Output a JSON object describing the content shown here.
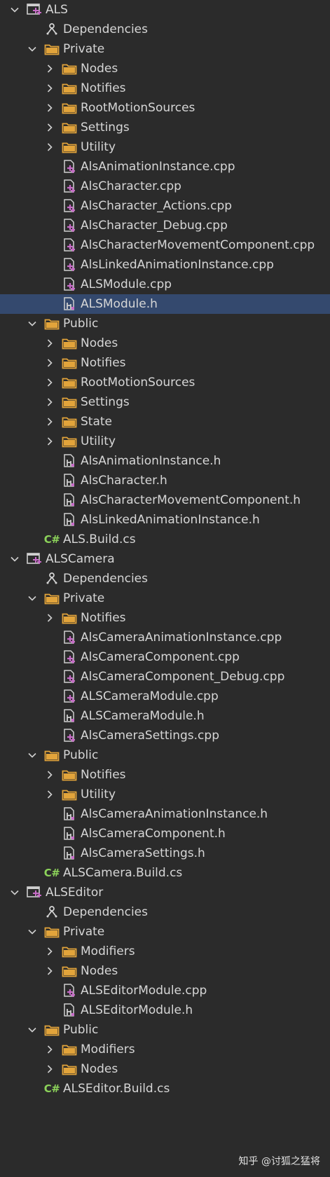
{
  "tree": [
    {
      "depth": 0,
      "type": "project",
      "chevron": "down",
      "label": "ALS"
    },
    {
      "depth": 1,
      "type": "deps",
      "chevron": "none",
      "label": "Dependencies"
    },
    {
      "depth": 1,
      "type": "folder",
      "chevron": "down",
      "label": "Private"
    },
    {
      "depth": 2,
      "type": "folder",
      "chevron": "right",
      "label": "Nodes"
    },
    {
      "depth": 2,
      "type": "folder",
      "chevron": "right",
      "label": "Notifies"
    },
    {
      "depth": 2,
      "type": "folder",
      "chevron": "right",
      "label": "RootMotionSources"
    },
    {
      "depth": 2,
      "type": "folder",
      "chevron": "right",
      "label": "Settings"
    },
    {
      "depth": 2,
      "type": "folder",
      "chevron": "right",
      "label": "Utility"
    },
    {
      "depth": 2,
      "type": "cpp",
      "chevron": "none",
      "label": "AlsAnimationInstance.cpp"
    },
    {
      "depth": 2,
      "type": "cpp",
      "chevron": "none",
      "label": "AlsCharacter.cpp"
    },
    {
      "depth": 2,
      "type": "cpp",
      "chevron": "none",
      "label": "AlsCharacter_Actions.cpp"
    },
    {
      "depth": 2,
      "type": "cpp",
      "chevron": "none",
      "label": "AlsCharacter_Debug.cpp"
    },
    {
      "depth": 2,
      "type": "cpp",
      "chevron": "none",
      "label": "AlsCharacterMovementComponent.cpp"
    },
    {
      "depth": 2,
      "type": "cpp",
      "chevron": "none",
      "label": "AlsLinkedAnimationInstance.cpp"
    },
    {
      "depth": 2,
      "type": "cpp",
      "chevron": "none",
      "label": "ALSModule.cpp"
    },
    {
      "depth": 2,
      "type": "h",
      "chevron": "none",
      "label": "ALSModule.h",
      "selected": true
    },
    {
      "depth": 1,
      "type": "folder",
      "chevron": "down",
      "label": "Public"
    },
    {
      "depth": 2,
      "type": "folder",
      "chevron": "right",
      "label": "Nodes"
    },
    {
      "depth": 2,
      "type": "folder",
      "chevron": "right",
      "label": "Notifies"
    },
    {
      "depth": 2,
      "type": "folder",
      "chevron": "right",
      "label": "RootMotionSources"
    },
    {
      "depth": 2,
      "type": "folder",
      "chevron": "right",
      "label": "Settings"
    },
    {
      "depth": 2,
      "type": "folder",
      "chevron": "right",
      "label": "State"
    },
    {
      "depth": 2,
      "type": "folder",
      "chevron": "right",
      "label": "Utility"
    },
    {
      "depth": 2,
      "type": "h",
      "chevron": "none",
      "label": "AlsAnimationInstance.h"
    },
    {
      "depth": 2,
      "type": "h",
      "chevron": "none",
      "label": "AlsCharacter.h"
    },
    {
      "depth": 2,
      "type": "h",
      "chevron": "none",
      "label": "AlsCharacterMovementComponent.h"
    },
    {
      "depth": 2,
      "type": "h",
      "chevron": "none",
      "label": "AlsLinkedAnimationInstance.h"
    },
    {
      "depth": 1,
      "type": "cs",
      "chevron": "none",
      "label": "ALS.Build.cs"
    },
    {
      "depth": 0,
      "type": "project",
      "chevron": "down",
      "label": "ALSCamera"
    },
    {
      "depth": 1,
      "type": "deps",
      "chevron": "none",
      "label": "Dependencies"
    },
    {
      "depth": 1,
      "type": "folder",
      "chevron": "down",
      "label": "Private"
    },
    {
      "depth": 2,
      "type": "folder",
      "chevron": "right",
      "label": "Notifies"
    },
    {
      "depth": 2,
      "type": "cpp",
      "chevron": "none",
      "label": "AlsCameraAnimationInstance.cpp"
    },
    {
      "depth": 2,
      "type": "cpp",
      "chevron": "none",
      "label": "AlsCameraComponent.cpp"
    },
    {
      "depth": 2,
      "type": "cpp",
      "chevron": "none",
      "label": "AlsCameraComponent_Debug.cpp"
    },
    {
      "depth": 2,
      "type": "cpp",
      "chevron": "none",
      "label": "ALSCameraModule.cpp"
    },
    {
      "depth": 2,
      "type": "h",
      "chevron": "none",
      "label": "ALSCameraModule.h"
    },
    {
      "depth": 2,
      "type": "cpp",
      "chevron": "none",
      "label": "AlsCameraSettings.cpp"
    },
    {
      "depth": 1,
      "type": "folder",
      "chevron": "down",
      "label": "Public"
    },
    {
      "depth": 2,
      "type": "folder",
      "chevron": "right",
      "label": "Notifies"
    },
    {
      "depth": 2,
      "type": "folder",
      "chevron": "right",
      "label": "Utility"
    },
    {
      "depth": 2,
      "type": "h",
      "chevron": "none",
      "label": "AlsCameraAnimationInstance.h"
    },
    {
      "depth": 2,
      "type": "h",
      "chevron": "none",
      "label": "AlsCameraComponent.h"
    },
    {
      "depth": 2,
      "type": "h",
      "chevron": "none",
      "label": "AlsCameraSettings.h"
    },
    {
      "depth": 1,
      "type": "cs",
      "chevron": "none",
      "label": "ALSCamera.Build.cs"
    },
    {
      "depth": 0,
      "type": "project",
      "chevron": "down",
      "label": "ALSEditor"
    },
    {
      "depth": 1,
      "type": "deps",
      "chevron": "none",
      "label": "Dependencies"
    },
    {
      "depth": 1,
      "type": "folder",
      "chevron": "down",
      "label": "Private"
    },
    {
      "depth": 2,
      "type": "folder",
      "chevron": "right",
      "label": "Modifiers"
    },
    {
      "depth": 2,
      "type": "folder",
      "chevron": "right",
      "label": "Nodes"
    },
    {
      "depth": 2,
      "type": "cpp",
      "chevron": "none",
      "label": "ALSEditorModule.cpp"
    },
    {
      "depth": 2,
      "type": "h",
      "chevron": "none",
      "label": "ALSEditorModule.h"
    },
    {
      "depth": 1,
      "type": "folder",
      "chevron": "down",
      "label": "Public"
    },
    {
      "depth": 2,
      "type": "folder",
      "chevron": "right",
      "label": "Modifiers"
    },
    {
      "depth": 2,
      "type": "folder",
      "chevron": "right",
      "label": "Nodes"
    },
    {
      "depth": 1,
      "type": "cs",
      "chevron": "none",
      "label": "ALSEditor.Build.cs"
    }
  ],
  "icons": {
    "project": "project-icon",
    "deps": "dependencies-icon",
    "folder": "folder-icon",
    "cpp": "cpp-file-icon",
    "h": "header-file-icon",
    "cs": "csharp-file-icon"
  },
  "cs_badge": "C#",
  "colors": {
    "background": "#2b2b2b",
    "selection": "#34496e",
    "folder": "#e2a43b",
    "cpp_accent": "#c76bc7",
    "csharp": "#8cd35a"
  },
  "watermark": "知乎 @讨狐之猛将"
}
